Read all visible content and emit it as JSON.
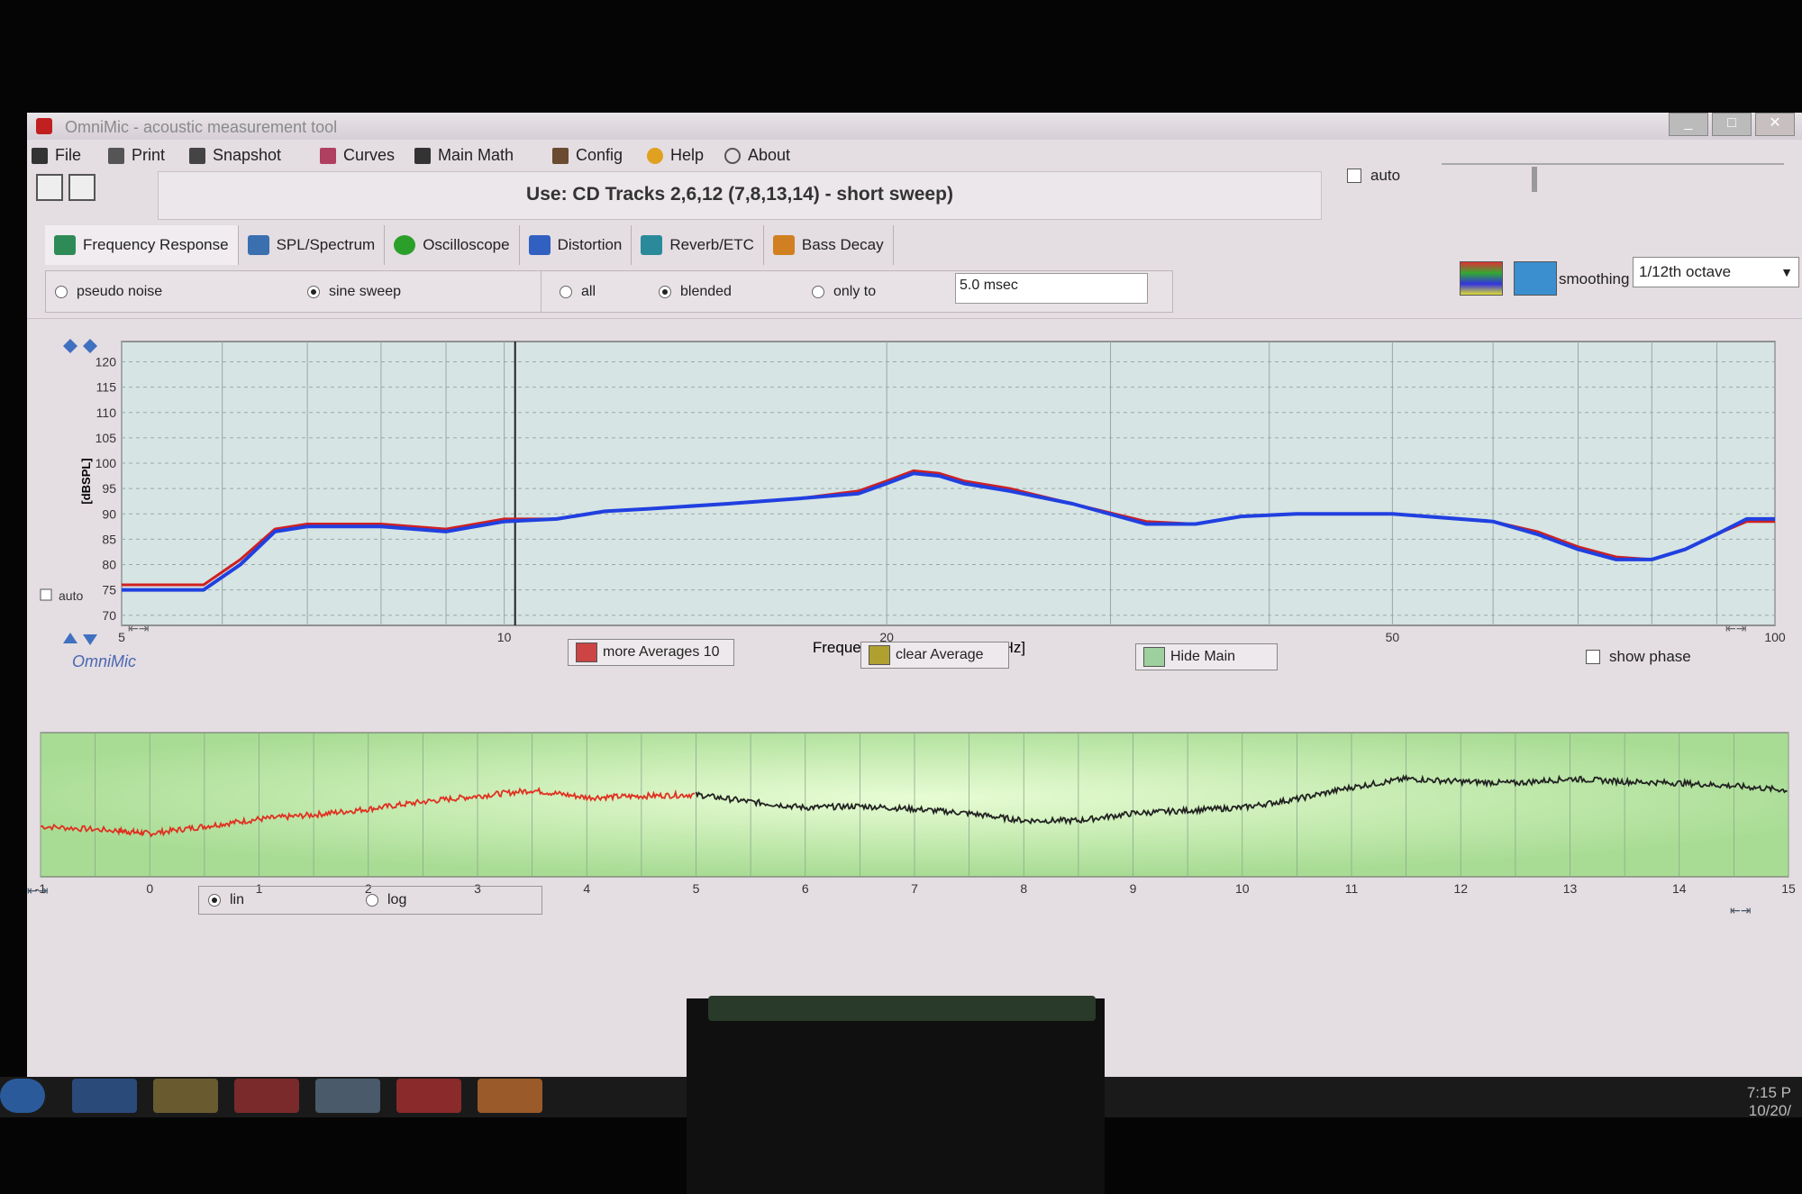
{
  "window": {
    "title": "OmniMic - acoustic measurement tool",
    "controls": [
      "_",
      "□",
      "✕"
    ]
  },
  "menu": [
    {
      "label": "File",
      "icon": "save-icon"
    },
    {
      "label": "Print",
      "icon": "printer-icon"
    },
    {
      "label": "Snapshot",
      "icon": "camera-icon"
    },
    {
      "label": "Curves",
      "icon": "curves-icon"
    },
    {
      "label": "Main Math",
      "icon": "calculator-icon"
    },
    {
      "label": "Config",
      "icon": "tools-icon"
    },
    {
      "label": "Help",
      "icon": "question-icon"
    },
    {
      "label": "About",
      "icon": "speech-bubble-icon"
    }
  ],
  "use_text": "Use: CD Tracks 2,6,12 (7,8,13,14) - short sweep)",
  "top_auto_label": "auto",
  "tabs": [
    {
      "label": "Frequency Response",
      "color": "#2e8b57"
    },
    {
      "label": "SPL/Spectrum",
      "color": "#3a6fb0"
    },
    {
      "label": "Oscilloscope",
      "color": "#2aa02a"
    },
    {
      "label": "Distortion",
      "color": "#3060c0"
    },
    {
      "label": "Reverb/ETC",
      "color": "#2a8a9a"
    },
    {
      "label": "Bass Decay",
      "color": "#d08020"
    }
  ],
  "stimulus": {
    "options": [
      "pseudo noise",
      "sine sweep"
    ],
    "selected": "sine sweep"
  },
  "gating": {
    "options": [
      "all",
      "blended",
      "only to"
    ],
    "selected": "blended",
    "value": "5.0 msec"
  },
  "smoothing": {
    "label": "smoothing",
    "value": "1/12th octave"
  },
  "main_chart_ui": {
    "auto_label": "auto",
    "logo": "OmniMic",
    "buttons": {
      "more_averages": "more Averages 10",
      "clear_average": "clear Average",
      "hide_main": "Hide Main"
    },
    "show_phase": "show phase"
  },
  "lower_chart_ui": {
    "scale_options": [
      "lin",
      "log"
    ],
    "selected": "lin"
  },
  "chart_data": [
    {
      "type": "line",
      "title": "",
      "xlabel": "Frequency Response -freq [Hz]",
      "ylabel": "[dBSPL]",
      "xscale": "log",
      "xlim": [
        5,
        100
      ],
      "ylim": [
        68,
        124
      ],
      "x_tick_labels": [
        "5",
        "10",
        "20",
        "50",
        "100"
      ],
      "y_ticks": [
        70,
        75,
        80,
        85,
        90,
        95,
        100,
        105,
        110,
        115,
        120
      ],
      "grid": true,
      "cursor_x": 10.2,
      "series": [
        {
          "color": "#d02020",
          "x": [
            5,
            5.8,
            6.2,
            6.6,
            7,
            8,
            9,
            10,
            11,
            12,
            13,
            15,
            17,
            19,
            20,
            21,
            22,
            23,
            25,
            28,
            32,
            35,
            38,
            42,
            50,
            60,
            65,
            70,
            75,
            80,
            85,
            90,
            95,
            100
          ],
          "y": [
            76,
            76,
            81,
            87,
            88,
            88,
            87,
            89,
            89,
            90.5,
            91,
            92,
            93,
            94.5,
            96.5,
            98.5,
            98,
            96.5,
            95,
            92,
            88.5,
            88,
            89.5,
            90,
            90,
            88.5,
            86.5,
            83.5,
            81.5,
            81,
            83,
            86,
            88.5,
            88.5
          ]
        },
        {
          "color": "#2040e0",
          "x": [
            5,
            5.8,
            6.2,
            6.6,
            7,
            8,
            9,
            10,
            11,
            12,
            13,
            15,
            17,
            19,
            20,
            21,
            22,
            23,
            25,
            28,
            32,
            35,
            38,
            42,
            50,
            60,
            65,
            70,
            75,
            80,
            85,
            90,
            95,
            100
          ],
          "y": [
            75,
            75,
            80,
            86.5,
            87.5,
            87.5,
            86.5,
            88.5,
            89,
            90.5,
            91,
            92,
            93,
            94,
            96,
            98,
            97.5,
            96,
            94.5,
            92,
            88,
            88,
            89.5,
            90,
            90,
            88.5,
            86,
            83,
            81,
            81,
            83,
            86,
            89,
            89
          ]
        }
      ]
    },
    {
      "type": "line",
      "title": "",
      "x_tick_labels": [
        "-1",
        "0",
        "1",
        "2",
        "3",
        "4",
        "5",
        "6",
        "7",
        "8",
        "9",
        "10",
        "11",
        "12",
        "13",
        "14",
        "15"
      ],
      "xlim": [
        -1,
        15
      ],
      "ylim": [
        0,
        1
      ],
      "grid": true,
      "series": [
        {
          "color": "#e03020",
          "x": [
            -1,
            -0.3,
            0,
            0.5,
            1,
            1.5,
            2,
            2.5,
            3,
            3.5,
            4,
            4.5,
            5
          ],
          "y": [
            0.35,
            0.32,
            0.3,
            0.35,
            0.4,
            0.43,
            0.47,
            0.52,
            0.56,
            0.6,
            0.55,
            0.56,
            0.57
          ]
        },
        {
          "color": "#222222",
          "x": [
            5,
            5.5,
            6,
            6.5,
            7,
            7.5,
            8,
            8.5,
            9,
            9.5,
            10,
            10.5,
            11,
            11.5,
            12,
            12.5,
            13,
            13.5,
            14,
            14.5,
            15
          ],
          "y": [
            0.57,
            0.52,
            0.48,
            0.49,
            0.47,
            0.44,
            0.39,
            0.39,
            0.44,
            0.46,
            0.48,
            0.54,
            0.62,
            0.68,
            0.66,
            0.65,
            0.68,
            0.66,
            0.65,
            0.63,
            0.6
          ]
        }
      ]
    }
  ],
  "taskbar": {
    "time": "7:15 P",
    "date": "10/20/"
  }
}
